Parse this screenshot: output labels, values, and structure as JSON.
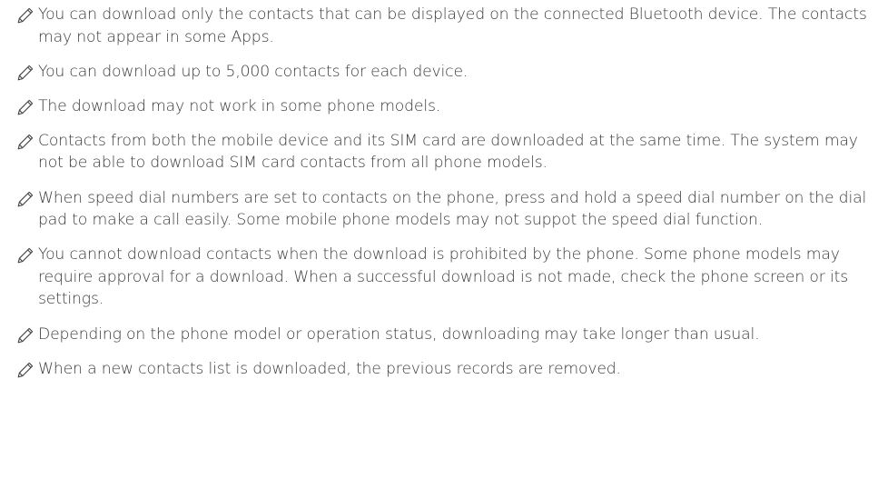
{
  "notes": [
    {
      "icon": "pencil-icon",
      "text": "You can download only the contacts that can be displayed on the connected Bluetooth device. The contacts may not appear in some Apps."
    },
    {
      "icon": "pencil-icon",
      "text": "You can download up to 5,000 contacts for each device."
    },
    {
      "icon": "pencil-icon",
      "text": "The download may not work in some phone models."
    },
    {
      "icon": "pencil-icon",
      "text": "Contacts from both the mobile device and its SIM card are downloaded at the same time. The system may not be able to download SIM card contacts from all phone models."
    },
    {
      "icon": "pencil-icon",
      "text": "When speed dial numbers are set to contacts on the phone, press and hold a speed dial number on the dial pad to make a call easily. Some mobile phone models may not suppot the speed dial function."
    },
    {
      "icon": "pencil-icon",
      "text": "You cannot download contacts when the download is prohibited by the phone. Some phone models may require approval for a download. When a successful download is not made, check the phone screen or its settings."
    },
    {
      "icon": "pencil-icon",
      "text": "Depending on the phone model or operation status, downloading may take longer than usual."
    },
    {
      "icon": "pencil-icon",
      "text": "When a new contacts list is downloaded, the previous records are removed."
    }
  ]
}
